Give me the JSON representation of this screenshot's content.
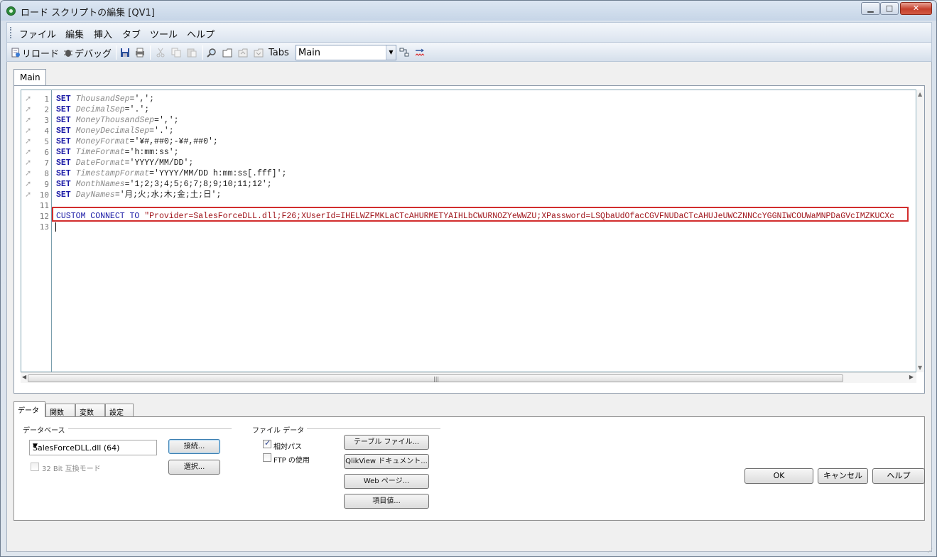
{
  "window": {
    "title": "ロード スクリプトの編集 [QV1]"
  },
  "menu": [
    "ファイル",
    "編集",
    "挿入",
    "タブ",
    "ツール",
    "ヘルプ"
  ],
  "toolbar": {
    "reload": "リロード",
    "debug": "デバッグ",
    "tabs_label": "Tabs",
    "tabs_selected": "Main"
  },
  "main_tab": "Main",
  "editor": {
    "line_numbers": [
      "1",
      "2",
      "3",
      "4",
      "5",
      "6",
      "7",
      "8",
      "9",
      "10",
      "11",
      "12",
      "13"
    ],
    "lines": [
      {
        "kw": "SET",
        "var": "ThousandSep",
        "rest": "=',';"
      },
      {
        "kw": "SET",
        "var": "DecimalSep",
        "rest": "='.';"
      },
      {
        "kw": "SET",
        "var": "MoneyThousandSep",
        "rest": "=',';"
      },
      {
        "kw": "SET",
        "var": "MoneyDecimalSep",
        "rest": "='.';"
      },
      {
        "kw": "SET",
        "var": "MoneyFormat",
        "rest": "='¥#,##0;-¥#,##0';"
      },
      {
        "kw": "SET",
        "var": "TimeFormat",
        "rest": "='h:mm:ss';"
      },
      {
        "kw": "SET",
        "var": "DateFormat",
        "rest": "='YYYY/MM/DD';"
      },
      {
        "kw": "SET",
        "var": "TimestampFormat",
        "rest": "='YYYY/MM/DD h:mm:ss[.fff]';"
      },
      {
        "kw": "SET",
        "var": "MonthNames",
        "rest": "='1;2;3;4;5;6;7;8;9;10;11;12';"
      },
      {
        "kw": "SET",
        "var": "DayNames",
        "rest": "='月;火;水;木;金;土;日';"
      }
    ],
    "connect_kw": "CUSTOM CONNECT TO",
    "connect_string": "\"Provider=SalesForceDLL.dll;F26;XUserId=IHELWZFMKLaCTcAHURMETYAIHLbCWURNOZYeWWZU;XPassword=LSQbaUdOfacCGVFNUDaCTcAHUJeUWCZNNCcYGGNIWCOUWaMNPDaGVcIMZKUCXc"
  },
  "bottom_tabs": [
    "データ",
    "関数",
    "変数",
    "設定"
  ],
  "data_panel": {
    "database_label": "データベース",
    "database_selected": "SalesForceDLL.dll (64)",
    "connect_button": "接続...",
    "select_button": "選択...",
    "compat_mode": "32 Bit 互換モード",
    "file_data_label": "ファイル データ",
    "relative_path": "相対パス",
    "use_ftp": "FTP の使用",
    "table_files_button": "テーブル ファイル...",
    "qlikview_doc_button": "QlikView ドキュメント...",
    "web_page_button": "Web ページ...",
    "field_data_button": "項目値..."
  },
  "dialog": {
    "ok": "OK",
    "cancel": "キャンセル",
    "help": "ヘルプ"
  }
}
